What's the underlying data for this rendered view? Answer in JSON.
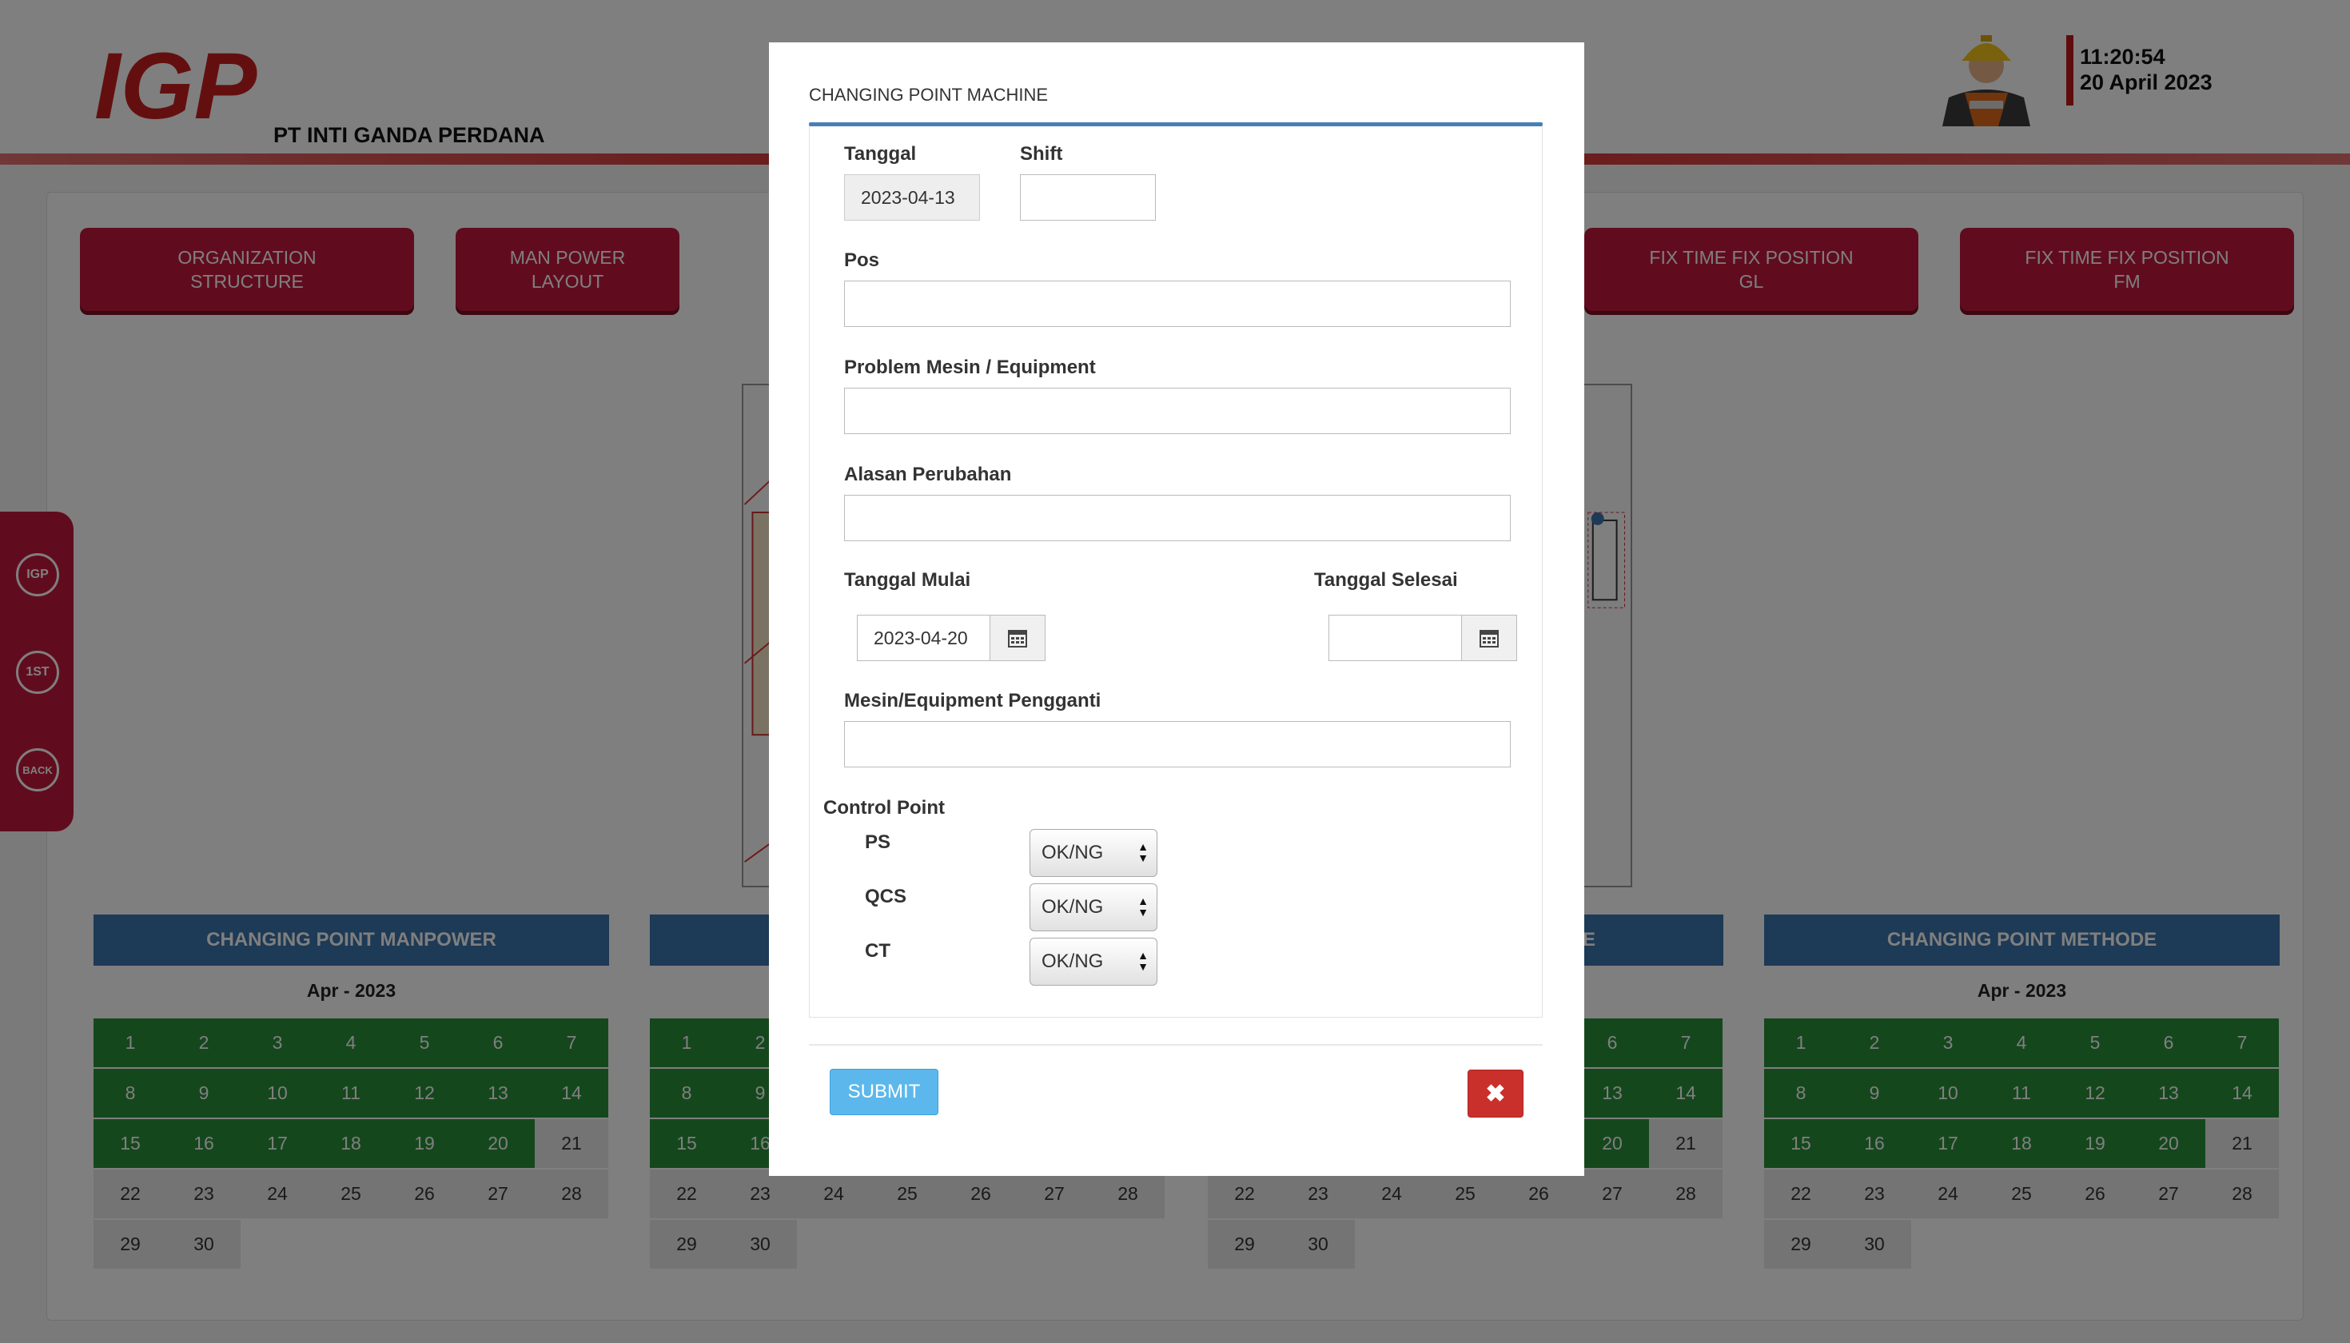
{
  "header": {
    "logo_text": "IGP",
    "company": "PT INTI GANDA PERDANA",
    "avatar_icon": "worker-helmet-icon",
    "time": "11:20:54",
    "date": "20 April 2023"
  },
  "nav_buttons": [
    {
      "label": "ORGANIZATION\nSTRUCTURE"
    },
    {
      "label": "MAN POWER\nLAYOUT"
    },
    {
      "label": "FIX TIME FIX POSITION\nGL"
    },
    {
      "label": "FIX TIME FIX POSITION\nFM"
    }
  ],
  "sidebar": {
    "items": [
      {
        "icon": "igp-home-icon",
        "text": "IGP"
      },
      {
        "icon": "first-icon",
        "text": "1ST"
      },
      {
        "icon": "back-icon",
        "text": "BACK"
      }
    ]
  },
  "calendars": [
    {
      "title": "CHANGING POINT MANPOWER",
      "month": "Apr - 2023"
    },
    {
      "title": "",
      "month": ""
    },
    {
      "title": "E",
      "month": ""
    },
    {
      "title": "CHANGING POINT METHODE",
      "month": "Apr - 2023"
    }
  ],
  "calendar_days": [
    "1",
    "2",
    "3",
    "4",
    "5",
    "6",
    "7",
    "8",
    "9",
    "10",
    "11",
    "12",
    "13",
    "14",
    "15",
    "16",
    "17",
    "18",
    "19",
    "20",
    "21",
    "22",
    "23",
    "24",
    "25",
    "26",
    "27",
    "28",
    "29",
    "30"
  ],
  "calendar_highlight_through": 20,
  "colors": {
    "accent": "#c3193c",
    "calendar_head": "#3b74ac",
    "past_day": "#2b8f3a",
    "submit": "#5cb8ec",
    "close": "#c9302c"
  },
  "modal": {
    "title": "CHANGING POINT MACHINE",
    "tanggal": {
      "label": "Tanggal",
      "value": "2023-04-13"
    },
    "shift": {
      "label": "Shift",
      "value": ""
    },
    "pos": {
      "label": "Pos",
      "value": ""
    },
    "problem": {
      "label": "Problem Mesin / Equipment",
      "value": ""
    },
    "alasan": {
      "label": "Alasan Perubahan",
      "value": ""
    },
    "tanggal_mulai": {
      "label": "Tanggal Mulai",
      "value": "2023-04-20",
      "icon": "calendar-icon"
    },
    "tanggal_selesai": {
      "label": "Tanggal Selesai",
      "value": "",
      "icon": "calendar-icon"
    },
    "pengganti": {
      "label": "Mesin/Equipment Pengganti",
      "value": ""
    },
    "control_point": {
      "label": "Control Point",
      "items": [
        {
          "label": "PS",
          "value": "OK/NG"
        },
        {
          "label": "QCS",
          "value": "OK/NG"
        },
        {
          "label": "CT",
          "value": "OK/NG"
        }
      ]
    },
    "submit_label": "SUBMIT",
    "close_icon": "close-icon"
  }
}
